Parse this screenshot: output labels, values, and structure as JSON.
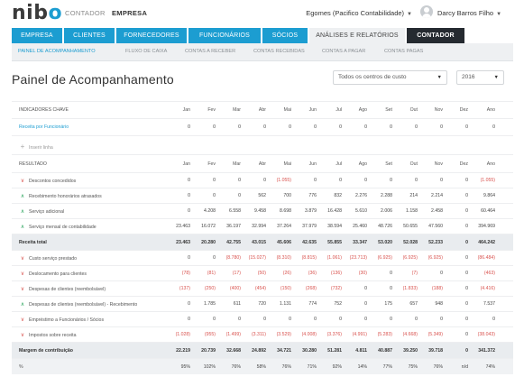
{
  "header": {
    "logo": "nibo",
    "nav": [
      "CONTADOR",
      "EMPRESA"
    ],
    "company": "Egomes (Pacifico Contabilidade)",
    "user": "Darcy Barros Filho"
  },
  "tabs": [
    "EMPRESA",
    "CLIENTES",
    "FORNECEDORES",
    "FUNCIONÁRIOS",
    "SÓCIOS",
    "ANÁLISES E RELATÓRIOS",
    "CONTADOR"
  ],
  "subtabs": [
    "PAINEL DE ACOMPANHAMENTO",
    "FLUXO DE CAIXA",
    "CONTAS A RECEBER",
    "CONTAS RECEBIDAS",
    "CONTAS A PAGAR",
    "CONTAS PAGAS"
  ],
  "page": {
    "title": "Painel de Acompanhamento",
    "cost_center": "Todos os centros de custo",
    "year": "2016"
  },
  "months": [
    "Jan",
    "Fev",
    "Mar",
    "Abr",
    "Mai",
    "Jun",
    "Jul",
    "Ago",
    "Set",
    "Out",
    "Nov",
    "Dez",
    "Ano"
  ],
  "table": {
    "indicators_header": "INDICADORES CHAVE",
    "indicators": [
      {
        "label": "Receita por Funcionário",
        "values": [
          "0",
          "0",
          "0",
          "0",
          "0",
          "0",
          "0",
          "0",
          "0",
          "0",
          "0",
          "0",
          "0"
        ]
      }
    ],
    "add_label": "Inserir linha",
    "result_header": "RESULTADO",
    "result_rows": [
      {
        "label": "Descontos concedidos",
        "icon": "down",
        "values": [
          "0",
          "0",
          "0",
          "0",
          "(1.055)",
          "0",
          "0",
          "0",
          "0",
          "0",
          "0",
          "0",
          "(1.055)"
        ]
      },
      {
        "label": "Recebimento honorários atrasados",
        "icon": "up",
        "values": [
          "0",
          "0",
          "0",
          "562",
          "700",
          "776",
          "832",
          "2.276",
          "2.288",
          "214",
          "2.214",
          "0",
          "9.864"
        ]
      },
      {
        "label": "Serviço adicional",
        "icon": "up",
        "values": [
          "0",
          "4.208",
          "6.558",
          "9.458",
          "8.698",
          "3.879",
          "16.428",
          "5.610",
          "2.006",
          "1.158",
          "2.458",
          "0",
          "60.464"
        ]
      },
      {
        "label": "Serviço mensal de contabilidade",
        "icon": "up",
        "values": [
          "23.463",
          "16.072",
          "36.197",
          "32.994",
          "37.264",
          "37.979",
          "38.594",
          "25.460",
          "48.726",
          "50.655",
          "47.560",
          "0",
          "394.969"
        ]
      }
    ],
    "revenue_total": {
      "label": "Receita total",
      "values": [
        "23.463",
        "20.280",
        "42.755",
        "43.015",
        "45.606",
        "42.635",
        "55.855",
        "33.347",
        "53.020",
        "52.028",
        "52.233",
        "0",
        "464.242"
      ]
    },
    "expense_rows": [
      {
        "label": "Custo serviço prestado",
        "icon": "down",
        "values": [
          "0",
          "0",
          "(8.780)",
          "(15.027)",
          "(8.310)",
          "(8.815)",
          "(1.061)",
          "(23.713)",
          "(6.925)",
          "(6.925)",
          "(6.925)",
          "0",
          "(86.484)"
        ]
      },
      {
        "label": "Deslocamento para clientes",
        "icon": "down",
        "values": [
          "(78)",
          "(81)",
          "(17)",
          "(50)",
          "(26)",
          "(36)",
          "(136)",
          "(30)",
          "0",
          "(7)",
          "0",
          "0",
          "(463)"
        ]
      },
      {
        "label": "Despesas de clientes (reembolsável)",
        "icon": "down",
        "values": [
          "(137)",
          "(250)",
          "(400)",
          "(454)",
          "(150)",
          "(268)",
          "(732)",
          "0",
          "0",
          "(1.833)",
          "(188)",
          "0",
          "(4.416)"
        ]
      },
      {
        "label": "Despesas de clientes (reembolsável) - Recebimento",
        "icon": "up",
        "values": [
          "0",
          "1.785",
          "611",
          "720",
          "1.131",
          "774",
          "752",
          "0",
          "175",
          "657",
          "948",
          "0",
          "7.537"
        ]
      },
      {
        "label": "Empréstimo a Funcionários / Sócios",
        "icon": "down",
        "values": [
          "0",
          "0",
          "0",
          "0",
          "0",
          "0",
          "0",
          "0",
          "0",
          "0",
          "0",
          "0",
          "0"
        ]
      },
      {
        "label": "Impostos sobre receita",
        "icon": "down",
        "values": [
          "(1.028)",
          "(955)",
          "(1.499)",
          "(3.311)",
          "(3.529)",
          "(4.008)",
          "(3.376)",
          "(4.991)",
          "(5.283)",
          "(4.668)",
          "(5.349)",
          "0",
          "(38.043)"
        ]
      }
    ],
    "margin": {
      "label": "Margem de contribuição",
      "values": [
        "22.219",
        "20.739",
        "32.668",
        "24.892",
        "34.721",
        "30.280",
        "51.281",
        "4.811",
        "40.887",
        "39.250",
        "39.718",
        "0",
        "341.372"
      ]
    },
    "percent": {
      "label": "%",
      "values": [
        "95%",
        "102%",
        "76%",
        "58%",
        "76%",
        "71%",
        "92%",
        "14%",
        "77%",
        "75%",
        "76%",
        "n/d",
        "74%"
      ]
    }
  },
  "colors": {
    "brand_blue": "#1c9dd1",
    "dark_tab": "#252a30",
    "negative": "#d9534f",
    "positive": "#27a35a"
  }
}
